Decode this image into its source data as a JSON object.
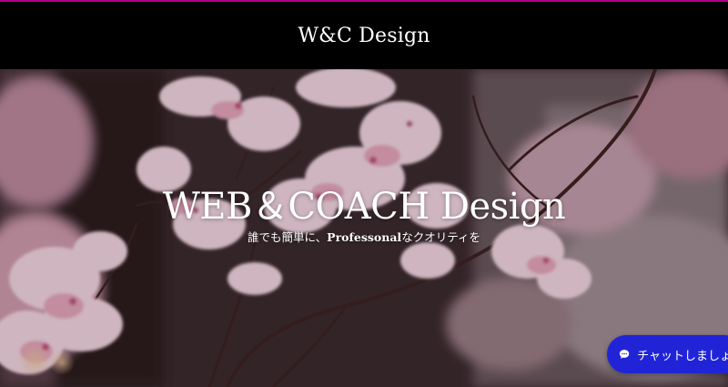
{
  "header": {
    "site_title": "W&C Design",
    "accent_color": "#b0008a"
  },
  "hero": {
    "title": "WEB＆COACH Design",
    "subtitle_prefix": "誰でも簡単に、",
    "subtitle_bold": "Professonal",
    "subtitle_suffix": "なクオリティを",
    "image_subject": "cherry-blossom-photo"
  },
  "chat": {
    "label": "チャットしましょう",
    "icon": "chat-bubble-icon",
    "color": "#2124d6"
  }
}
